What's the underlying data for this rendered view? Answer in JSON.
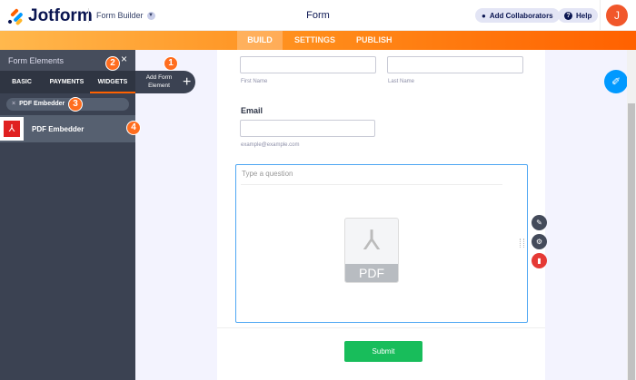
{
  "header": {
    "logo": "Jotform",
    "app_menu": "Form Builder",
    "title": "Form",
    "add_collaborators": "Add Collaborators",
    "help": "Help",
    "avatar_initial": "J"
  },
  "nav_tabs": [
    {
      "label": "BUILD",
      "active": true
    },
    {
      "label": "SETTINGS"
    },
    {
      "label": "PUBLISH"
    }
  ],
  "panel": {
    "title": "Form Elements",
    "tabs": [
      "BASIC",
      "PAYMENTS",
      "WIDGETS"
    ],
    "active_tab": "WIDGETS",
    "search_value": "PDF Embedder",
    "result": "PDF Embedder",
    "add_button": "Add Form Element"
  },
  "badges": [
    "1",
    "2",
    "3",
    "4"
  ],
  "form": {
    "first_name": "First Name",
    "last_name": "Last Name",
    "email_label": "Email",
    "email_hint": "example@example.com",
    "question_placeholder": "Type a question",
    "pdf_text": "PDF",
    "submit": "Submit"
  },
  "colors": {
    "accent": "#ff6100",
    "submit": "#18bd5b",
    "selected": "#4fa7f3",
    "delete": "#e53935"
  }
}
